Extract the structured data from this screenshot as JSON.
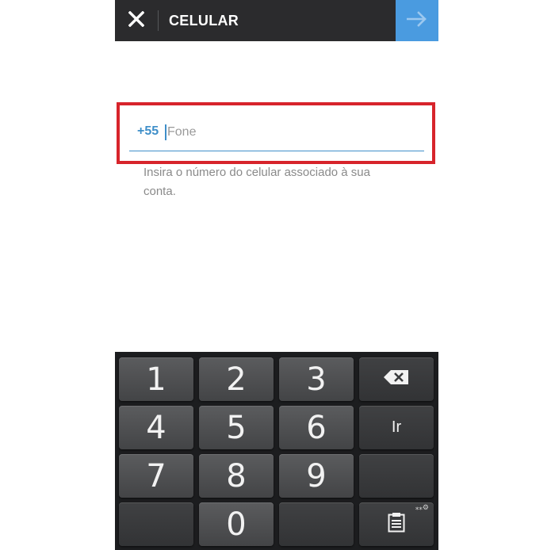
{
  "header": {
    "title": "CELULAR",
    "close_icon": "close-icon",
    "next_icon": "arrow-right-icon",
    "accent_color": "#4a9be0"
  },
  "form": {
    "country_code": "+55",
    "phone_placeholder": "Fone",
    "phone_value": "",
    "hint": "Insira o número do celular associado à sua conta.",
    "highlight_color": "#d7242b"
  },
  "keyboard": {
    "keys": [
      "1",
      "2",
      "3",
      "4",
      "5",
      "6",
      "7",
      "8",
      "9",
      "0"
    ],
    "go_label": "Ir",
    "backspace_icon": "backspace-icon",
    "clipboard_icon": "clipboard-icon",
    "settings_glyph": "⁎⁎⚙"
  }
}
